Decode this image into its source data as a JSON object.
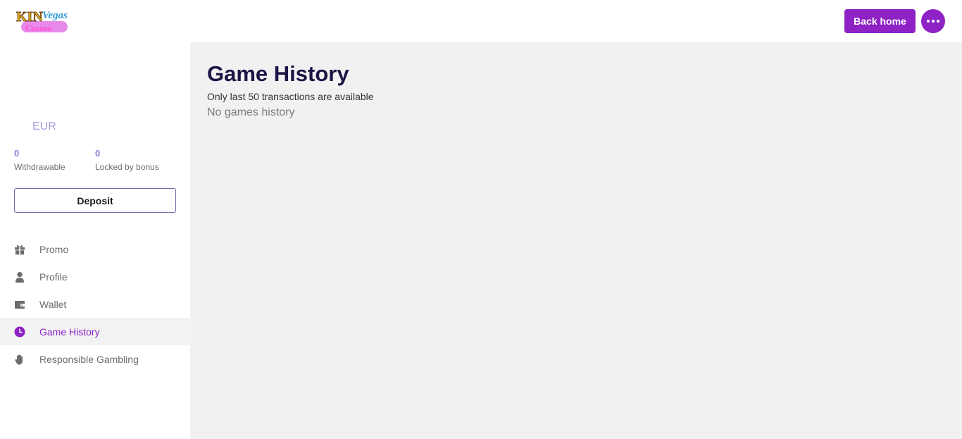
{
  "header": {
    "logo_text": "KIN Vegas Casino",
    "back_home_label": "Back home",
    "more_icon": "ellipsis-icon"
  },
  "account": {
    "currency": "EUR",
    "withdrawable_value": "0",
    "withdrawable_label": "Withdrawable",
    "locked_value": "0",
    "locked_label": "Locked by bonus",
    "deposit_label": "Deposit"
  },
  "nav": {
    "items": [
      {
        "label": "Promo",
        "icon": "gift-icon",
        "active": false
      },
      {
        "label": "Profile",
        "icon": "user-icon",
        "active": false
      },
      {
        "label": "Wallet",
        "icon": "wallet-icon",
        "active": false
      },
      {
        "label": "Game History",
        "icon": "clock-icon",
        "active": true
      },
      {
        "label": "Responsible Gambling",
        "icon": "hand-icon",
        "active": false
      }
    ]
  },
  "main": {
    "title": "Game History",
    "subtitle": "Only last 50 transactions are available",
    "empty_message": "No games history"
  },
  "colors": {
    "accent": "#8e22c4",
    "title": "#1e1444",
    "main_bg": "#f1f1f2",
    "stat_value": "#8b7fd6"
  }
}
